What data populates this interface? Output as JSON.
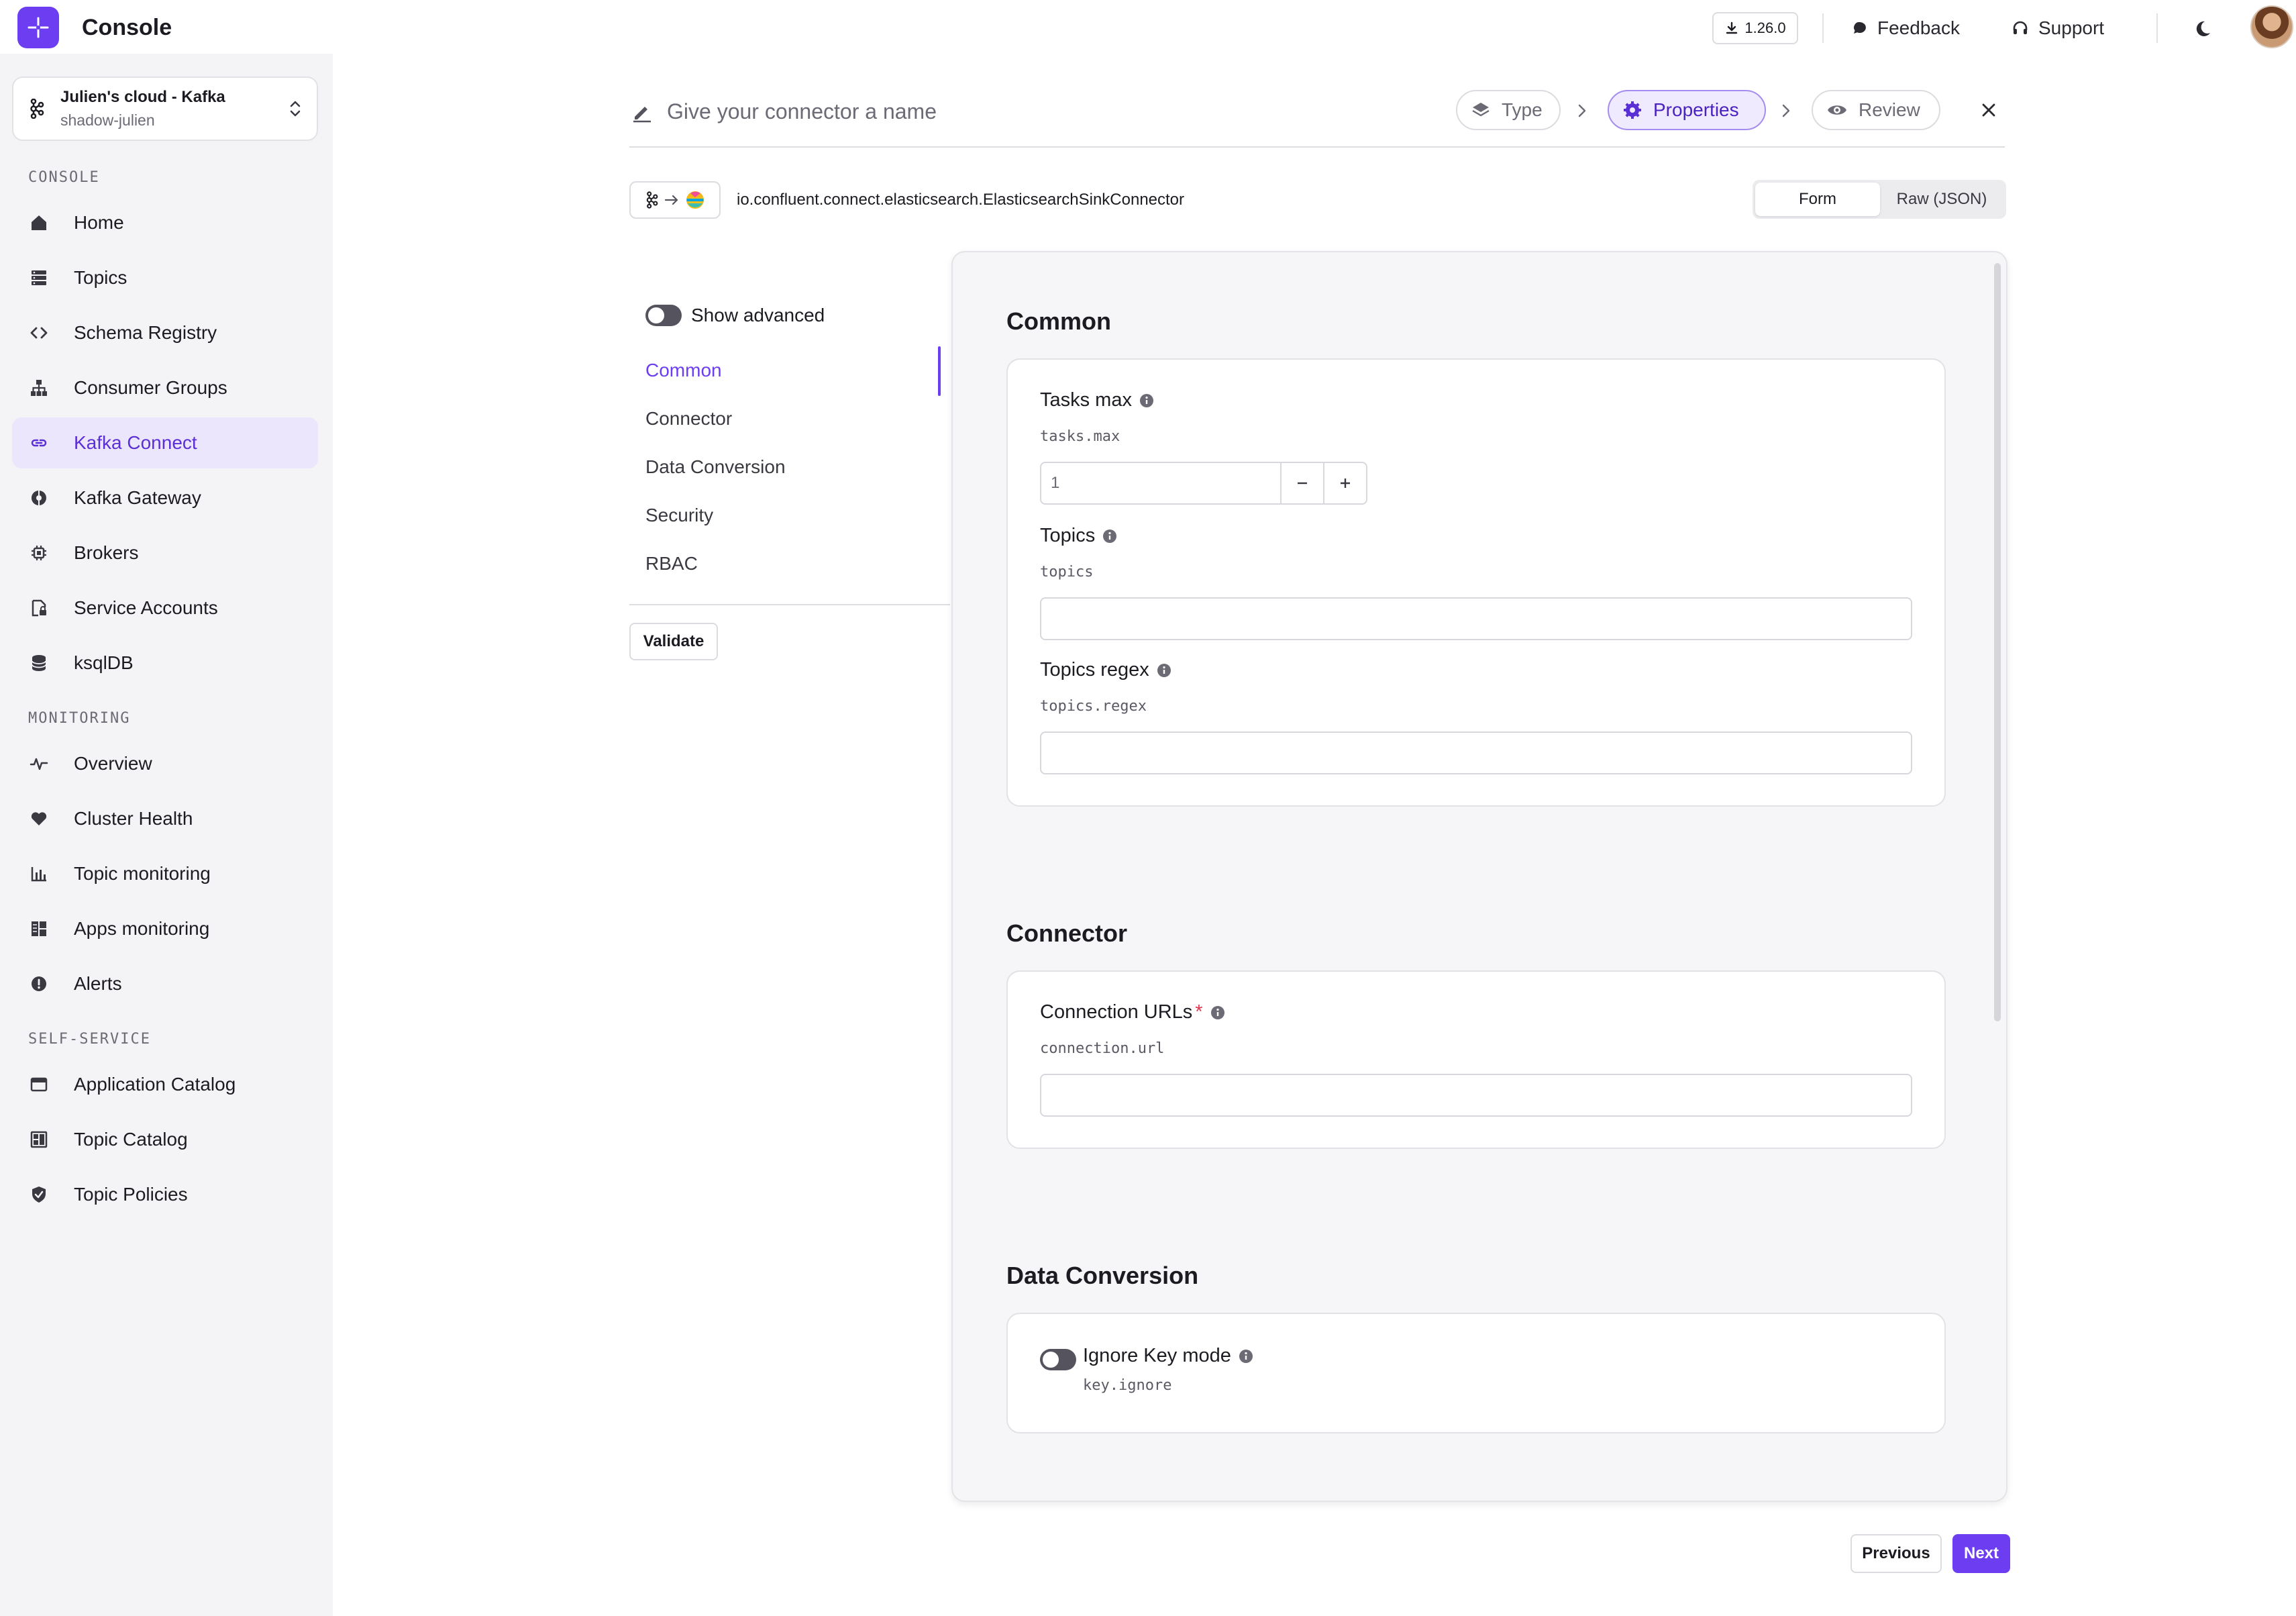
{
  "app": {
    "name": "Console"
  },
  "cluster": {
    "name": "Julien's cloud - Kafka",
    "sub": "shadow-julien"
  },
  "sidebar": {
    "sections": [
      {
        "label": "CONSOLE"
      },
      {
        "label": "MONITORING"
      },
      {
        "label": "SELF-SERVICE"
      }
    ],
    "items": [
      {
        "label": "Home",
        "icon": "home-icon"
      },
      {
        "label": "Topics",
        "icon": "topics-icon"
      },
      {
        "label": "Schema Registry",
        "icon": "code-icon"
      },
      {
        "label": "Consumer Groups",
        "icon": "hierarchy-icon"
      },
      {
        "label": "Kafka Connect",
        "icon": "link-icon",
        "active": true
      },
      {
        "label": "Kafka Gateway",
        "icon": "gateway-icon"
      },
      {
        "label": "Brokers",
        "icon": "chip-icon"
      },
      {
        "label": "Service Accounts",
        "icon": "lock-file-icon"
      },
      {
        "label": "ksqlDB",
        "icon": "database-icon"
      },
      {
        "label": "Overview",
        "icon": "pulse-icon"
      },
      {
        "label": "Cluster Health",
        "icon": "heart-icon"
      },
      {
        "label": "Topic monitoring",
        "icon": "bar-chart-icon"
      },
      {
        "label": "Apps monitoring",
        "icon": "grid-icon"
      },
      {
        "label": "Alerts",
        "icon": "alert-icon"
      },
      {
        "label": "Application Catalog",
        "icon": "window-icon"
      },
      {
        "label": "Topic Catalog",
        "icon": "catalog-icon"
      },
      {
        "label": "Topic Policies",
        "icon": "shield-icon"
      }
    ]
  },
  "topbar": {
    "version": "1.26.0",
    "feedback": "Feedback",
    "support": "Support"
  },
  "header": {
    "name_placeholder": "Give your connector a name",
    "steps": [
      {
        "label": "Type",
        "icon": "layers-icon"
      },
      {
        "label": "Properties",
        "icon": "gear-icon",
        "active": true
      },
      {
        "label": "Review",
        "icon": "eye-icon"
      }
    ],
    "connector_class": "io.confluent.connect.elasticsearch.ElasticsearchSinkConnector",
    "view_modes": [
      "Form",
      "Raw (JSON)"
    ],
    "active_view": "Form"
  },
  "form_nav": {
    "show_advanced": "Show advanced",
    "items": [
      "Common",
      "Connector",
      "Data Conversion",
      "Security",
      "RBAC"
    ],
    "active": "Common",
    "validate": "Validate"
  },
  "groups": {
    "common": {
      "title": "Common",
      "fields": [
        {
          "label": "Tasks max",
          "key": "tasks.max",
          "value": "1"
        },
        {
          "label": "Topics",
          "key": "topics",
          "value": ""
        },
        {
          "label": "Topics regex",
          "key": "topics.regex",
          "value": ""
        }
      ]
    },
    "connector": {
      "title": "Connector",
      "fields": [
        {
          "label": "Connection URLs",
          "required": "*",
          "key": "connection.url",
          "value": ""
        }
      ]
    },
    "data_conversion": {
      "title": "Data Conversion",
      "fields": [
        {
          "label": "Ignore Key mode",
          "key": "key.ignore",
          "enabled": false
        }
      ]
    }
  },
  "footer": {
    "previous": "Previous",
    "next": "Next"
  },
  "colors": {
    "accent": "#6d3ef1",
    "active_bg": "#ebe6fb",
    "required": "#e0364f"
  }
}
